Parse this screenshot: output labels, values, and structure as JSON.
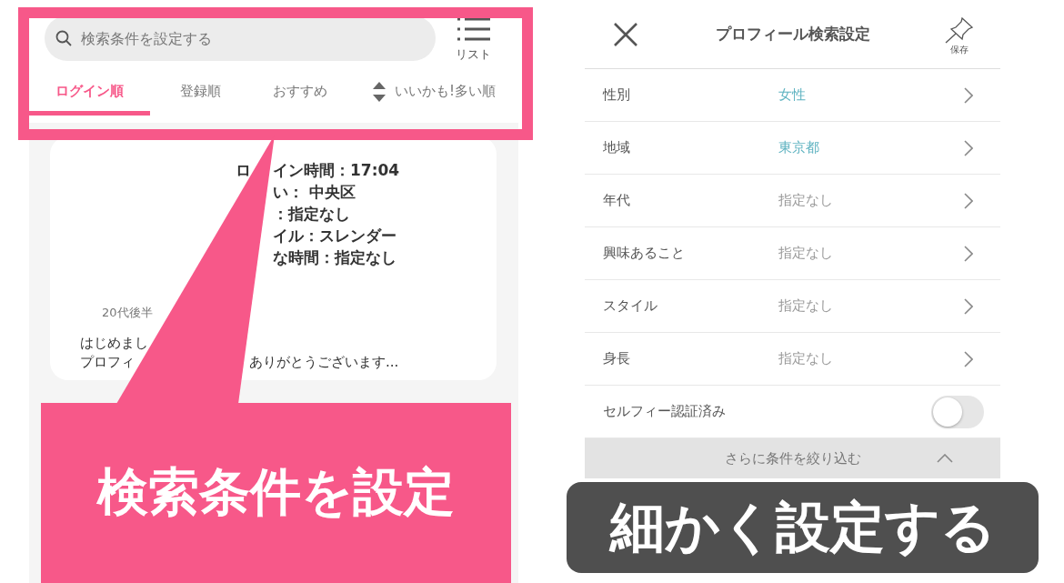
{
  "search_screen": {
    "search": {
      "placeholder": "検索条件を設定する"
    },
    "list_button": {
      "label": "リスト"
    },
    "sort_tabs": [
      {
        "label": "ログイン順",
        "selected": true,
        "kind": "plain"
      },
      {
        "label": "登録順",
        "selected": false,
        "kind": "plain"
      },
      {
        "label": "おすすめ",
        "selected": false,
        "kind": "plain"
      },
      {
        "label": "いいかも!多い順",
        "selected": false,
        "kind": "sortable"
      }
    ],
    "profile_card": {
      "details": [
        {
          "left": "ロ",
          "right": "イン時間：17:04"
        },
        {
          "right": "い： 中央区"
        },
        {
          "right": "：指定なし"
        },
        {
          "right": "イル：スレンダー"
        },
        {
          "right": "な時間：指定なし"
        }
      ],
      "age": "20代後半",
      "message": [
        {
          "left": "はじめまし"
        },
        {
          "left": "プロフィ",
          "right": "ありがとうございます..."
        }
      ]
    }
  },
  "left_callout": {
    "text": "検索条件を設定"
  },
  "settings_screen": {
    "title": "プロフィール検索設定",
    "save_label": "保存",
    "rows": [
      {
        "label": "性別",
        "value": "女性",
        "kind": "select",
        "value_set": true
      },
      {
        "label": "地域",
        "value": "東京都",
        "kind": "select",
        "value_set": true
      },
      {
        "label": "年代",
        "value": "指定なし",
        "kind": "select",
        "value_set": false
      },
      {
        "label": "興味あること",
        "value": "指定なし",
        "kind": "select",
        "value_set": false
      },
      {
        "label": "スタイル",
        "value": "指定なし",
        "kind": "select",
        "value_set": false
      },
      {
        "label": "身長",
        "value": "指定なし",
        "kind": "select",
        "value_set": false
      },
      {
        "label": "セルフィー認証済み",
        "kind": "toggle",
        "on": false
      }
    ],
    "more_filters": {
      "label": "さらに条件を絞り込む",
      "expanded": true
    }
  },
  "right_callout": {
    "text": "細かく設定する"
  }
}
